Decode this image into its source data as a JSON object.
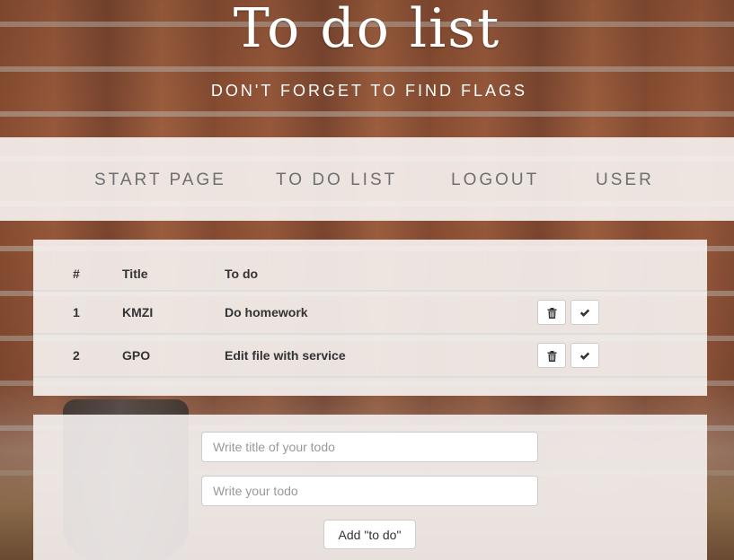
{
  "header": {
    "title": "To do list",
    "subtitle": "DON'T FORGET TO FIND FLAGS"
  },
  "nav": {
    "start_page": "START PAGE",
    "todo_list": "TO DO LIST",
    "logout": "LOGOUT",
    "user": "USER"
  },
  "table": {
    "columns": [
      "#",
      "Title",
      "To do"
    ],
    "rows": [
      {
        "num": "1",
        "title": "KMZI",
        "todo": "Do homework"
      },
      {
        "num": "2",
        "title": "GPO",
        "todo": "Edit file with service"
      }
    ],
    "delete_icon": "trash-icon",
    "done_icon": "check-icon"
  },
  "form": {
    "title_placeholder": "Write title of your todo",
    "title_value": "",
    "todo_placeholder": "Write your todo",
    "todo_value": "",
    "add_label": "Add \"to do\""
  },
  "colors": {
    "panel": "#f5f1ef",
    "nav_text": "#6e6e6e",
    "header_text": "#ffffff"
  }
}
